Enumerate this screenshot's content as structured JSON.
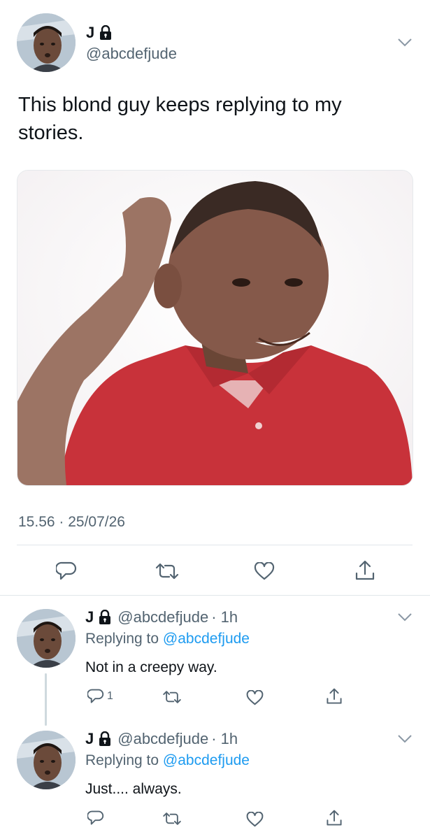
{
  "main_tweet": {
    "author_name": "J",
    "author_handle": "@abcdefjude",
    "text": "This blond guy keeps replying to my stories.",
    "timestamp": "15.56 · 25/07/26"
  },
  "replies": [
    {
      "author_name": "J",
      "author_handle": "@abcdefjude",
      "time": "· 1h",
      "replying_prefix": "Replying to",
      "replying_to": "@abcdefjude",
      "text": "Not in a creepy way.",
      "reply_count": "1"
    },
    {
      "author_name": "J",
      "author_handle": "@abcdefjude",
      "time": "· 1h",
      "replying_prefix": "Replying to",
      "replying_to": "@abcdefjude",
      "text": "Just.... always.",
      "reply_count": ""
    }
  ],
  "icons": [
    "lock-icon",
    "chevron-down-icon",
    "reply-icon",
    "retweet-icon",
    "like-icon",
    "share-icon"
  ],
  "colors": {
    "text": "#0f1419",
    "secondary": "#536471",
    "link": "#1d9bf0",
    "divider": "#e1e6ea"
  }
}
